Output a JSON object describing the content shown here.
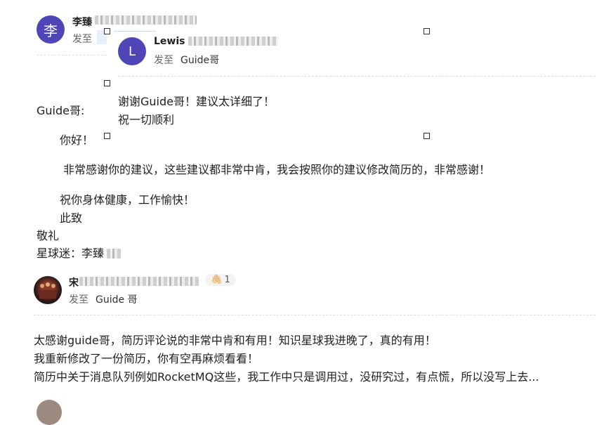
{
  "email1": {
    "avatar_char": "李",
    "sender": "李臻",
    "sent_to_label": "发至"
  },
  "quoted": {
    "avatar_char": "L",
    "sender": "Lewis",
    "sent_to_label": "发至",
    "recipient": "Guide哥",
    "lines": [
      "谢谢Guide哥！建议太详细了！",
      "祝一切顺利"
    ]
  },
  "letter": {
    "greeting": "Guide哥:",
    "hello": "你好！",
    "thanks": "非常感谢你的建议，这些建议都非常中肯，我会按照你的建议修改简历的，非常感谢！",
    "wish": "祝你身体健康，工作愉快！",
    "zhizhi": "此致",
    "jingli": "敬礼",
    "signature": "星球迷：李臻"
  },
  "email2": {
    "sender": "宋",
    "attachment_count": "1",
    "sent_to_label": "发至",
    "recipient": "Guide 哥",
    "lines": [
      "太感谢guide哥，简历评论说的非常中肯和有用！知识星球我进晚了，真的有用！",
      "我重新修改了一份简历，你有空再麻烦看看！",
      "简历中关于消息队列例如RocketMQ这些，我工作中只是调用过，没研究过，有点慌，所以没写上去..."
    ]
  },
  "colors": {
    "avatar_purple": "#4f45b6",
    "attachment_icon": "#e0902b"
  }
}
